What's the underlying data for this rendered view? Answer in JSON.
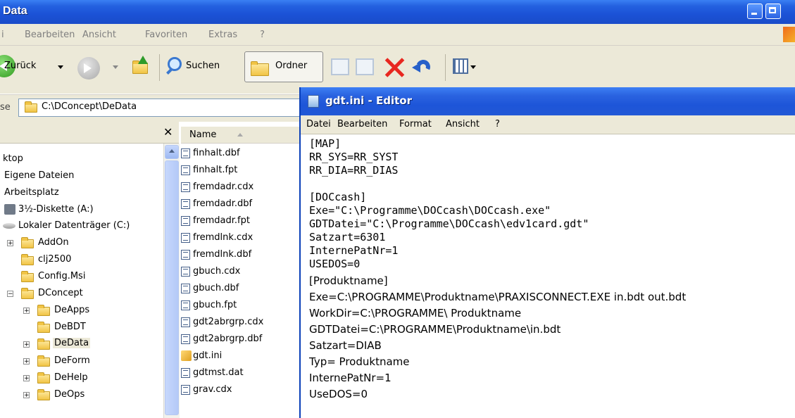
{
  "explorer": {
    "title": "Data",
    "menu": [
      "i",
      "Bearbeiten",
      "Ansicht",
      "Favoriten",
      "Extras",
      "?"
    ],
    "toolbar": {
      "back_label": "Zurück",
      "search_label": "Suchen",
      "folders_label": "Ordner"
    },
    "address": {
      "label": "se",
      "value": "C:\\DConcept\\DeData"
    },
    "tree": [
      "ktop",
      "Eigene Dateien",
      "Arbeitsplatz",
      "3½-Diskette (A:)",
      "Lokaler Datenträger (C:)",
      "AddOn",
      "clj2500",
      "Config.Msi",
      "DConcept",
      "DeApps",
      "DeBDT",
      "DeData",
      "DeForm",
      "DeHelp",
      "DeOps"
    ],
    "list_header": "Name",
    "files": [
      "finhalt.dbf",
      "finhalt.fpt",
      "fremdadr.cdx",
      "fremdadr.dbf",
      "fremdadr.fpt",
      "fremdlnk.cdx",
      "fremdlnk.dbf",
      "gbuch.cdx",
      "gbuch.dbf",
      "gbuch.fpt",
      "gdt2abrgrp.cdx",
      "gdt2abrgrp.dbf",
      "gdt.ini",
      "gdtmst.dat",
      "grav.cdx"
    ]
  },
  "editor": {
    "title": "gdt.ini - Editor",
    "menu": [
      "Datei",
      "Bearbeiten",
      "Format",
      "Ansicht",
      "?"
    ],
    "lines_mono": [
      "[MAP]",
      "RR_SYS=RR_SYST",
      "RR_DIA=RR_DIAS",
      "",
      "[DOCcash]",
      "Exe=\"C:\\Programme\\DOCcash\\DOCcash.exe\"",
      "GDTDatei=\"C:\\Programme\\DOCcash\\edv1card.gdt\"",
      "Satzart=6301",
      "InternePatNr=1",
      "USEDOS=0"
    ],
    "lines_sans": [
      "[Produktname]",
      "Exe=C:\\PROGRAMME\\Produktname\\PRAXISCONNECT.EXE in.bdt out.bdt",
      "WorkDir=C:\\PROGRAMME\\ Produktname",
      "GDTDatei=C:\\PROGRAMME\\Produktname\\in.bdt",
      "Satzart=DIAB",
      "Typ= Produktname",
      "InternePatNr=1",
      "UseDOS=0"
    ]
  }
}
